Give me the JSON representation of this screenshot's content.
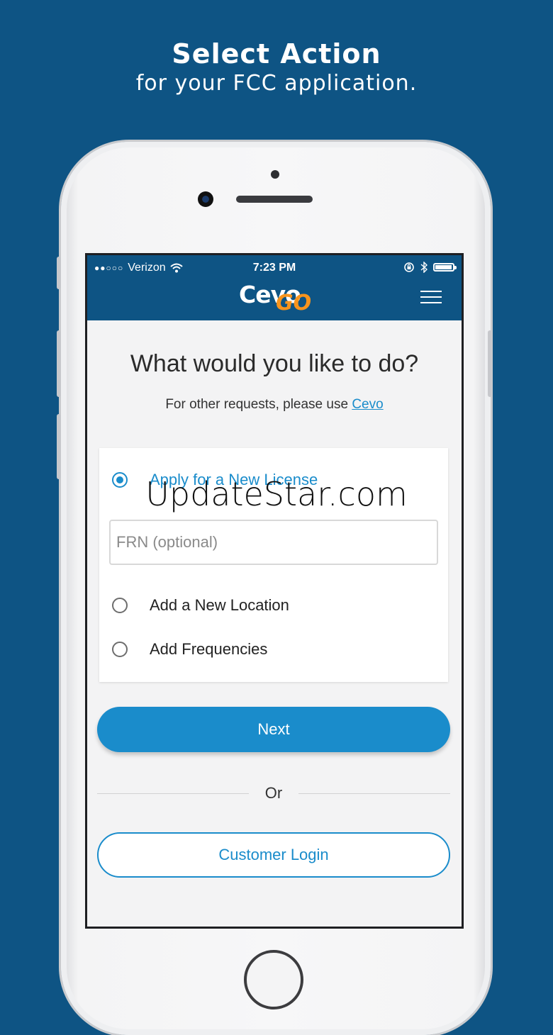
{
  "headline": {
    "title": "Select Action",
    "subtitle": "for your FCC application."
  },
  "status_bar": {
    "signal": "●●○○○",
    "carrier": "Verizon",
    "time": "7:23 PM"
  },
  "app_bar": {
    "logo_primary": "Cevo",
    "logo_secondary": "GO"
  },
  "main": {
    "heading": "What would you like to do?",
    "hint_prefix": "For other requests, please use",
    "hint_link": "Cevo"
  },
  "options": [
    {
      "label": "Apply for a New License",
      "selected": true
    },
    {
      "label": "Add a New Location",
      "selected": false
    },
    {
      "label": "Add Frequencies",
      "selected": false
    }
  ],
  "frn": {
    "value": "",
    "placeholder": "FRN (optional)"
  },
  "buttons": {
    "next": "Next",
    "or": "Or",
    "login": "Customer Login"
  },
  "colors": {
    "brand_blue": "#0e5484",
    "accent_blue": "#1a8ccb",
    "logo_orange": "#f7941d"
  },
  "watermark": "UpdateStar.com"
}
